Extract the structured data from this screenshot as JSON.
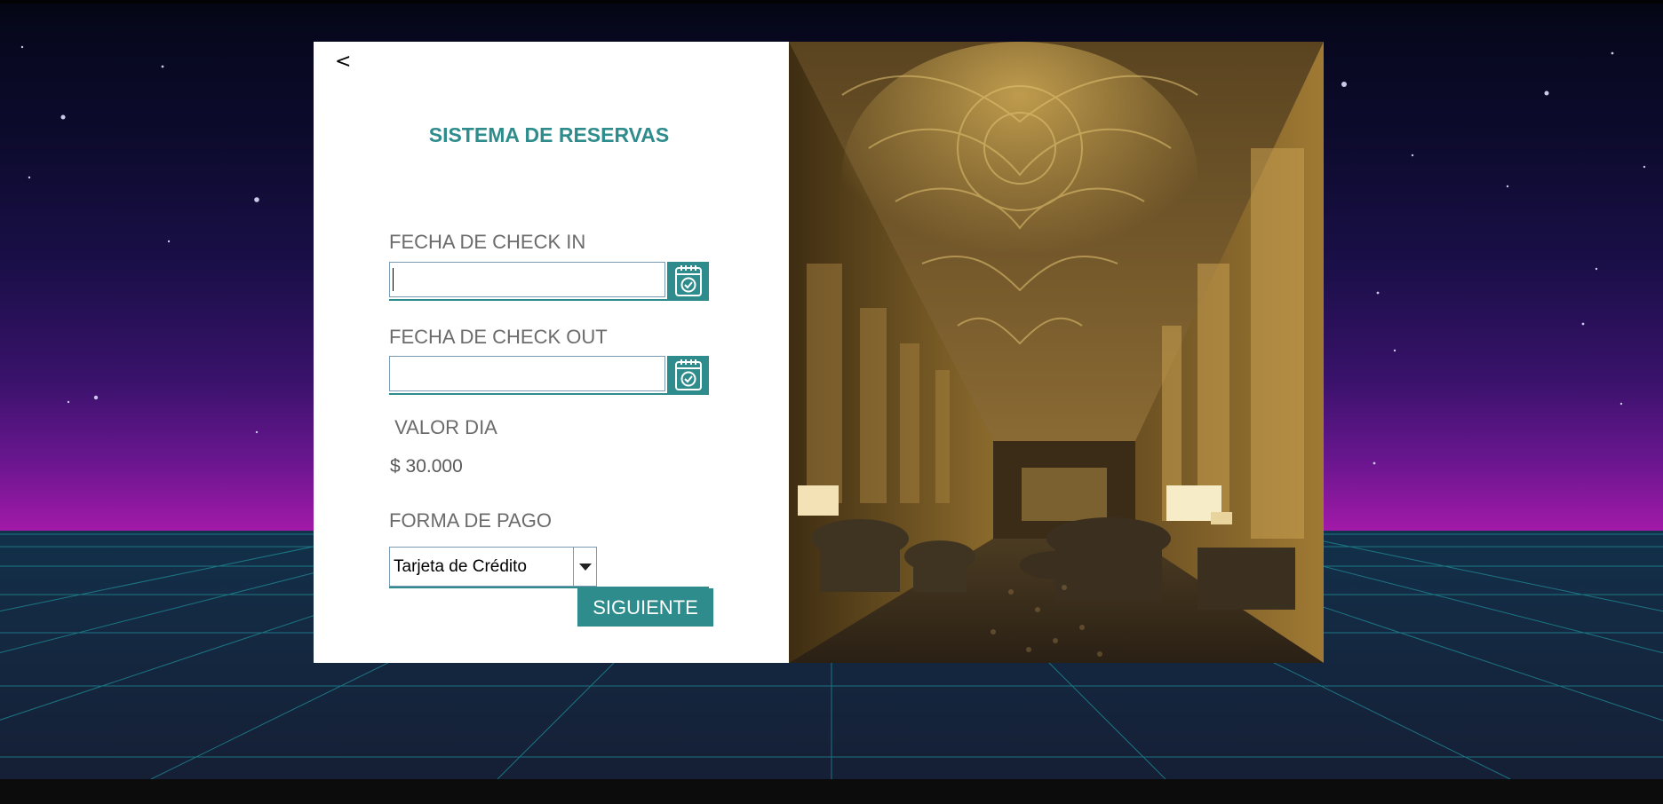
{
  "app": {
    "back_label": "<",
    "title": "SISTEMA DE RESERVAS"
  },
  "form": {
    "check_in_label": "FECHA DE CHECK IN",
    "check_in_value": "",
    "check_out_label": "FECHA DE CHECK OUT",
    "check_out_value": "",
    "valor_dia_label": " VALOR DIA",
    "valor_dia_value": "$ 30.000",
    "forma_pago_label": "FORMA DE PAGO",
    "forma_pago_selected": "Tarjeta de Crédito",
    "submit_label": "SIGUIENTE"
  },
  "icons": {
    "back": "chevron-left-icon",
    "calendar": "calendar-check-icon",
    "dropdown": "chevron-down-icon"
  },
  "colors": {
    "accent": "#2f8c8c",
    "card_background": "#ffffff",
    "label_text": "#6b6b6b",
    "input_border": "#7b9bb4"
  }
}
